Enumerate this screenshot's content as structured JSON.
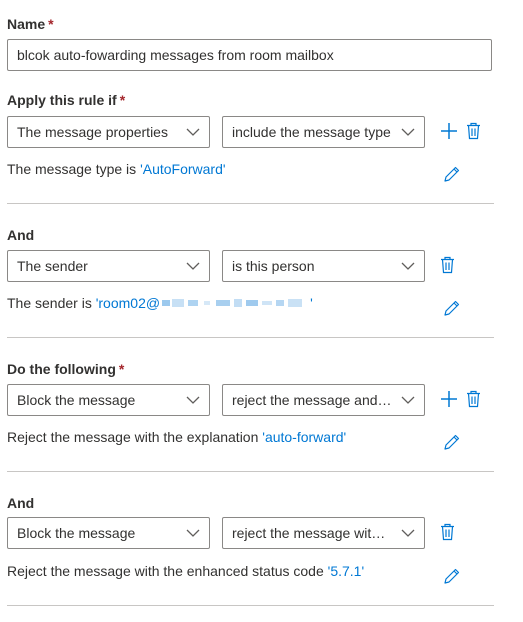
{
  "name_section": {
    "label": "Name",
    "required_mark": "*",
    "value": "blcok auto-fowarding messages from room mailbox"
  },
  "condition": {
    "label": "Apply this rule if",
    "required_mark": "*",
    "first_select": "The message properties",
    "second_select": "include the message type",
    "desc_prefix": "The message type is ",
    "desc_value": "'AutoForward'"
  },
  "and_condition": {
    "label": "And",
    "first_select": "The sender",
    "second_select": "is this person",
    "desc_prefix": "The sender is ",
    "desc_value_start": "'room02@",
    "desc_value_end": "'"
  },
  "action": {
    "label": "Do the following",
    "required_mark": "*",
    "first_select": "Block the message",
    "second_select": "reject the message and i...",
    "desc_prefix": "Reject the message with the explanation ",
    "desc_value": "'auto-forward'"
  },
  "and_action": {
    "label": "And",
    "first_select": "Block the message",
    "second_select": "reject the message with t...",
    "desc_prefix": "Reject the message with the enhanced status code ",
    "desc_value": "'5.7.1'"
  },
  "colors": {
    "accent": "#0078d4",
    "required": "#a4262c",
    "text": "#323130",
    "border": "#8a8886",
    "divider": "#c8c6c4"
  },
  "icons": [
    "chevron-down-icon",
    "add-icon",
    "delete-icon",
    "edit-icon"
  ]
}
